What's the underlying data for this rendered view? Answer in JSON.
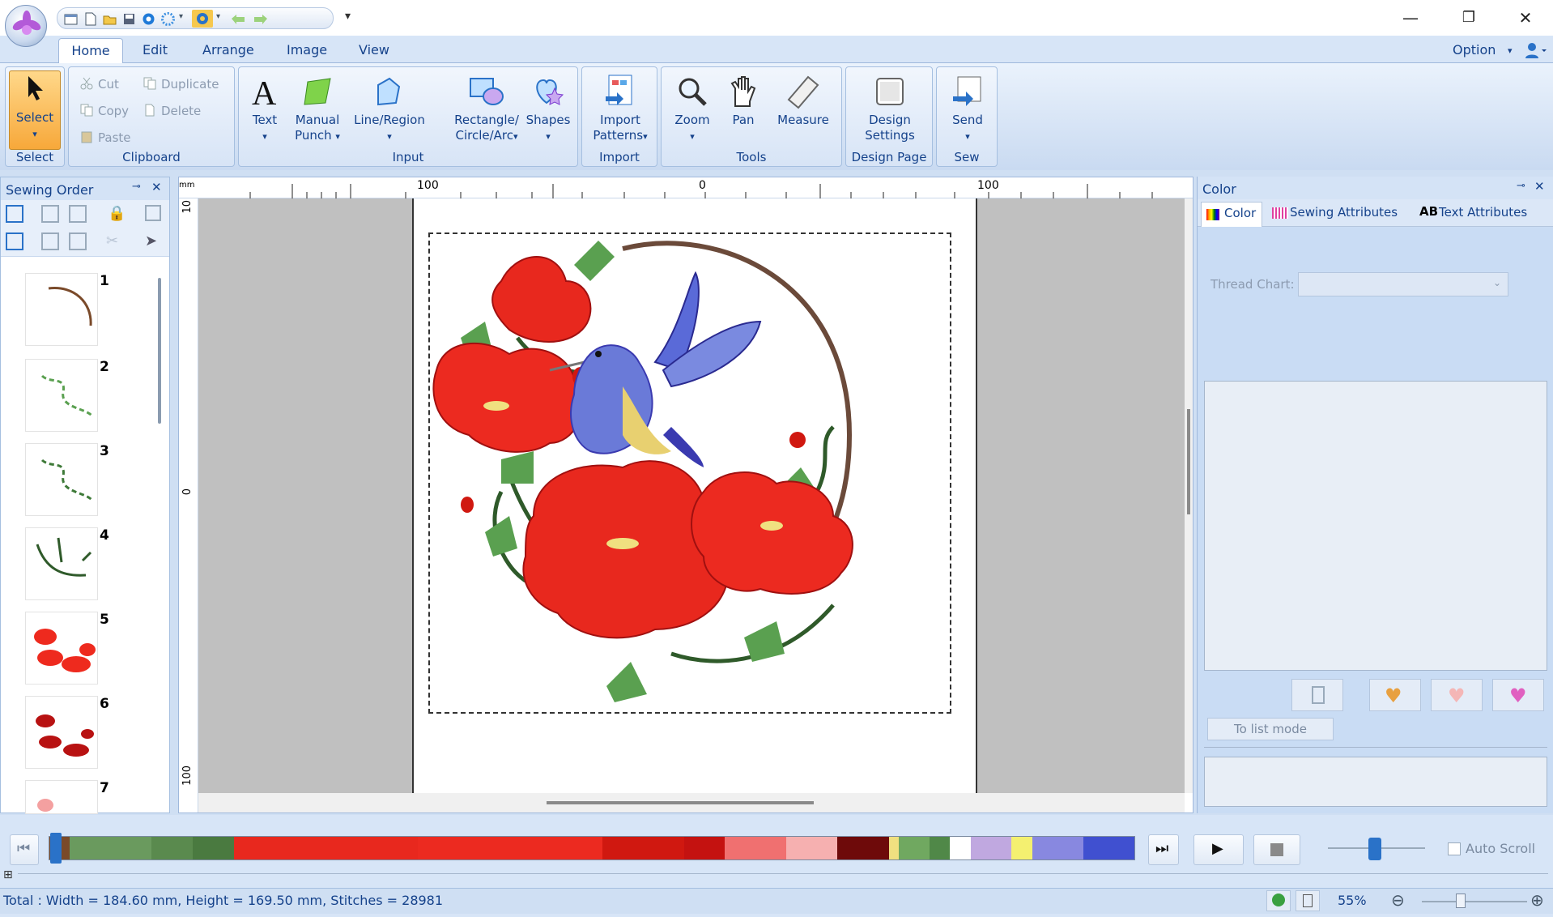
{
  "menu": {
    "tabs": [
      "Home",
      "Edit",
      "Arrange",
      "Image",
      "View"
    ],
    "option": "Option"
  },
  "ribbon": {
    "select": {
      "button": "Select",
      "group": "Select"
    },
    "clipboard": {
      "cut": "Cut",
      "copy": "Copy",
      "paste": "Paste",
      "duplicate": "Duplicate",
      "delete": "Delete",
      "group": "Clipboard"
    },
    "input": {
      "text": "Text",
      "manual_punch_1": "Manual",
      "manual_punch_2": "Punch",
      "line_region": "Line/Region",
      "rect_1": "Rectangle/",
      "rect_2": "Circle/Arc",
      "shapes": "Shapes",
      "group": "Input"
    },
    "import": {
      "import_1": "Import",
      "import_2": "Patterns",
      "group": "Import"
    },
    "tools": {
      "zoom": "Zoom",
      "pan": "Pan",
      "measure": "Measure",
      "group": "Tools"
    },
    "design_page": {
      "ds_1": "Design",
      "ds_2": "Settings",
      "group": "Design Page"
    },
    "sew": {
      "send": "Send",
      "group": "Sew"
    }
  },
  "sewing_order": {
    "title": "Sewing Order",
    "items": [
      "1",
      "2",
      "3",
      "4",
      "5",
      "6",
      "7"
    ]
  },
  "ruler": {
    "unit": "mm",
    "h_left": "100",
    "h_mid": "0",
    "h_right": "100",
    "v_top": "10",
    "v_mid": "0",
    "v_bottom": "100"
  },
  "color_panel": {
    "title": "Color",
    "tab_color": "Color",
    "tab_sewing": "Sewing Attributes",
    "tab_text": "Text Attributes",
    "tab_text_prefix": "AB",
    "thread_chart": "Thread Chart:",
    "list_mode": "To list mode"
  },
  "palette": [
    "#7a4a2a",
    "#6a9a5e",
    "#5a8a4e",
    "#4a7a40",
    "#e8281e",
    "#ec2a20",
    "#d01810",
    "#c41210",
    "#f07070",
    "#f6b0b0",
    "#6e0a0a",
    "#f0e080",
    "#70a860",
    "#508848",
    "#ffffff",
    "#c0a8e0",
    "#f4f070",
    "#8888e0",
    "#4050d0"
  ],
  "playback": {
    "auto_scroll": "Auto Scroll"
  },
  "status": {
    "total": "Total : Width = 184.60 mm, Height = 169.50 mm, Stitches = 28981",
    "zoom": "55%"
  }
}
